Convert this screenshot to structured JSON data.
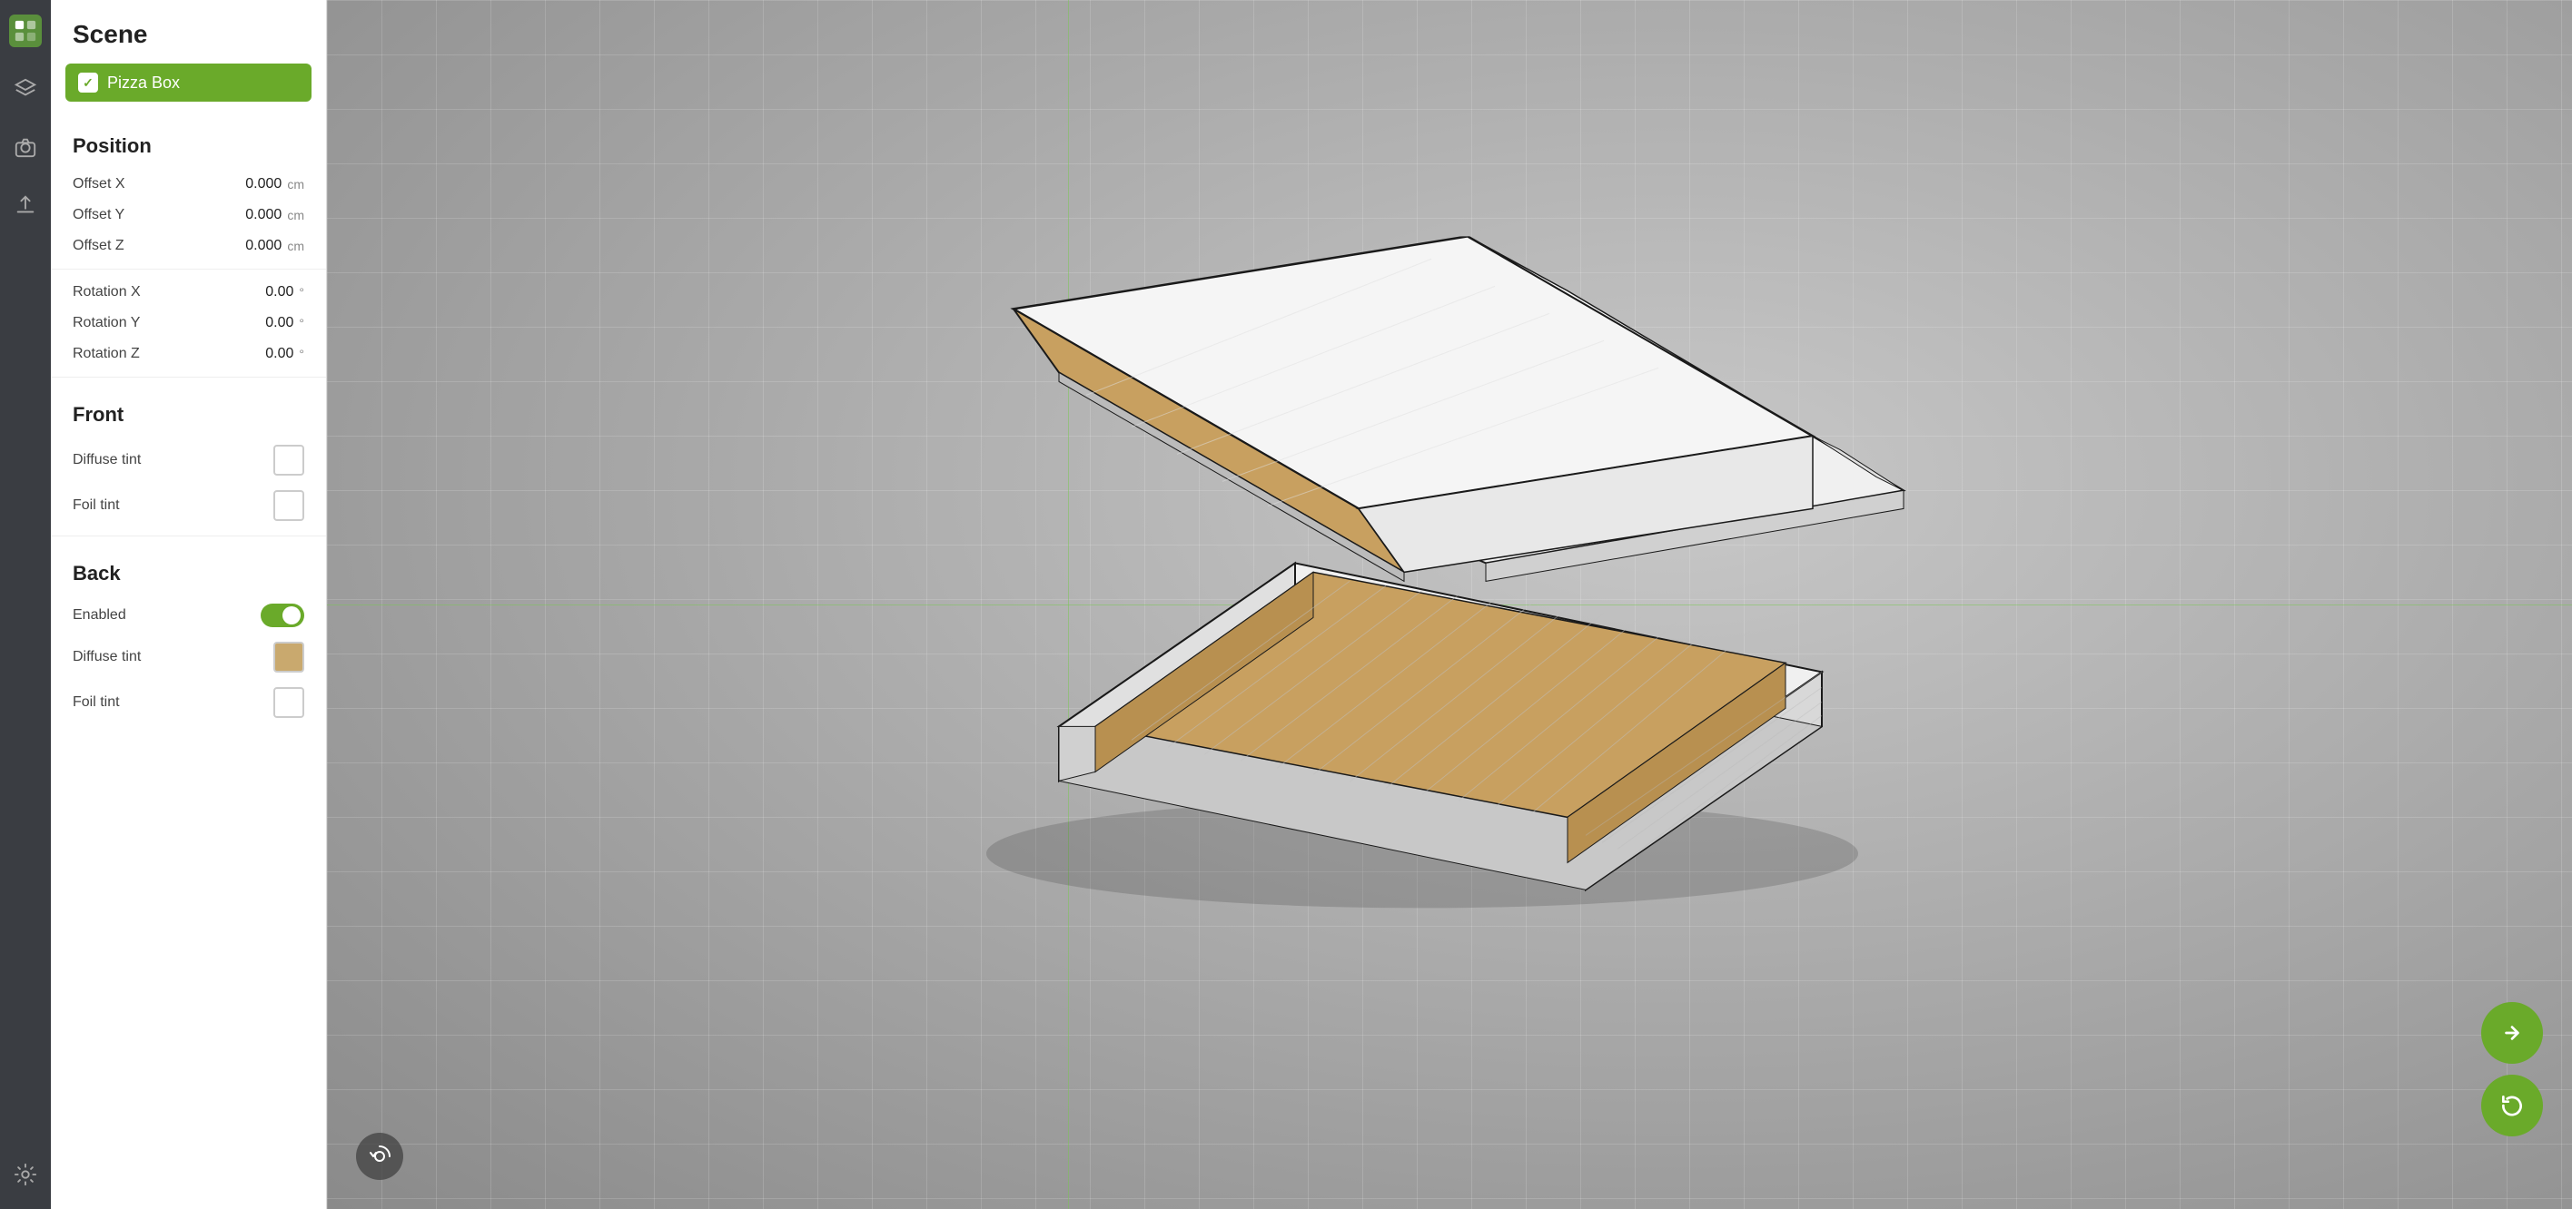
{
  "app": {
    "title": "Scene"
  },
  "icons": {
    "logo": "⬡",
    "layers": "⧉",
    "camera": "🎬",
    "upload": "⬆",
    "settings": "⚙"
  },
  "scene": {
    "item_label": "Pizza Box",
    "item_checked": true
  },
  "position": {
    "section_title": "Position",
    "offset_x_label": "Offset X",
    "offset_x_value": "0.000",
    "offset_x_unit": "cm",
    "offset_y_label": "Offset Y",
    "offset_y_value": "0.000",
    "offset_y_unit": "cm",
    "offset_z_label": "Offset Z",
    "offset_z_value": "0.000",
    "offset_z_unit": "cm",
    "rotation_x_label": "Rotation X",
    "rotation_x_value": "0.00",
    "rotation_x_unit": "°",
    "rotation_y_label": "Rotation Y",
    "rotation_y_value": "0.00",
    "rotation_y_unit": "°",
    "rotation_z_label": "Rotation Z",
    "rotation_z_value": "0.00",
    "rotation_z_unit": "°"
  },
  "front": {
    "section_title": "Front",
    "diffuse_tint_label": "Diffuse tint",
    "foil_tint_label": "Foil tint"
  },
  "back": {
    "section_title": "Back",
    "enabled_label": "Enabled",
    "enabled_value": true,
    "diffuse_tint_label": "Diffuse tint",
    "diffuse_tint_color": "#c9a96e",
    "foil_tint_label": "Foil tint"
  },
  "viewport": {
    "reset_btn_label": "↺",
    "next_btn_label": "→",
    "refresh_btn_label": "↺"
  }
}
